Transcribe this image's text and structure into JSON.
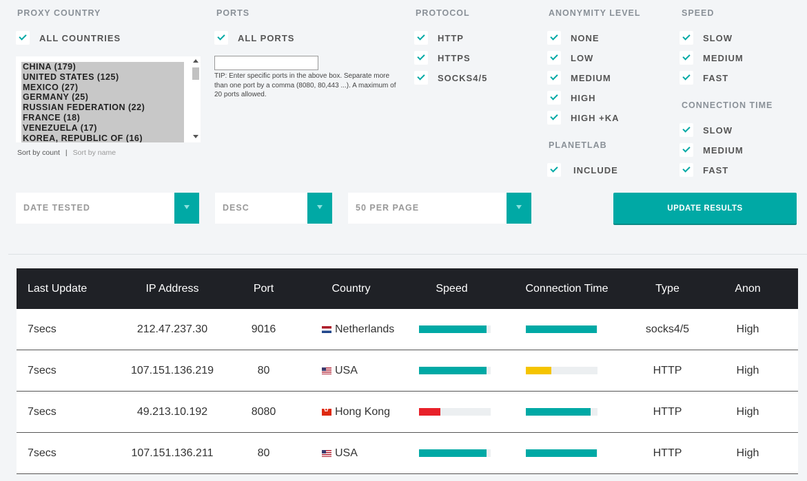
{
  "filters": {
    "proxy_country": {
      "header": "PROXY COUNTRY",
      "all_label": "ALL COUNTRIES",
      "countries": [
        "CHINA (179)",
        "UNITED STATES (125)",
        "MEXICO (27)",
        "GERMANY (25)",
        "RUSSIAN FEDERATION (22)",
        "FRANCE (18)",
        "VENEZUELA (17)",
        "KOREA, REPUBLIC OF (16)"
      ],
      "sort_by_count": "Sort by count",
      "sort_separator": "|",
      "sort_by_name": "Sort by name"
    },
    "ports": {
      "header": "PORTS",
      "all_label": "ALL PORTS",
      "input_value": "",
      "tip": "TIP: Enter specific ports in the above box. Separate more than one port by a comma (8080, 80,443 ...). A maximum of 20 ports allowed."
    },
    "protocol": {
      "header": "PROTOCOL",
      "options": [
        "HTTP",
        "HTTPS",
        "SOCKS4/5"
      ]
    },
    "anonymity": {
      "header": "ANONYMITY LEVEL",
      "options": [
        "NONE",
        "LOW",
        "MEDIUM",
        "HIGH",
        "HIGH +KA"
      ]
    },
    "planetlab": {
      "header": "PLANETLAB",
      "include_label": "INCLUDE"
    },
    "speed": {
      "header": "SPEED",
      "options": [
        "SLOW",
        "MEDIUM",
        "FAST"
      ]
    },
    "connection_time": {
      "header": "CONNECTION TIME",
      "options": [
        "SLOW",
        "MEDIUM",
        "FAST"
      ]
    }
  },
  "controls": {
    "sort_field": "DATE TESTED",
    "sort_order": "DESC",
    "per_page": "50 PER PAGE",
    "update_button": "UPDATE RESULTS"
  },
  "table": {
    "columns": [
      "Last Update",
      "IP Address",
      "Port",
      "Country",
      "Speed",
      "Connection Time",
      "Type",
      "Anon"
    ],
    "rows": [
      {
        "last_update": "7secs",
        "ip": "212.47.237.30",
        "port": "9016",
        "country": "Netherlands",
        "flag": "nl",
        "speed": 0.94,
        "speed_color": "#00a9a5",
        "conn": 0.99,
        "conn_color": "#00a9a5",
        "type": "socks4/5",
        "anon": "High"
      },
      {
        "last_update": "7secs",
        "ip": "107.151.136.219",
        "port": "80",
        "country": "USA",
        "flag": "us",
        "speed": 0.94,
        "speed_color": "#00a9a5",
        "conn": 0.36,
        "conn_color": "#f5c400",
        "type": "HTTP",
        "anon": "High"
      },
      {
        "last_update": "7secs",
        "ip": "49.213.10.192",
        "port": "8080",
        "country": "Hong Kong",
        "flag": "hk",
        "speed": 0.3,
        "speed_color": "#e8212a",
        "conn": 0.9,
        "conn_color": "#00a9a5",
        "type": "HTTP",
        "anon": "High"
      },
      {
        "last_update": "7secs",
        "ip": "107.151.136.211",
        "port": "80",
        "country": "USA",
        "flag": "us",
        "speed": 0.94,
        "speed_color": "#00a9a5",
        "conn": 0.99,
        "conn_color": "#00a9a5",
        "type": "HTTP",
        "anon": "High"
      }
    ]
  },
  "colors": {
    "accent": "#00a9a5",
    "header_bg": "#1f2126",
    "page_bg": "#f3f5f7"
  }
}
